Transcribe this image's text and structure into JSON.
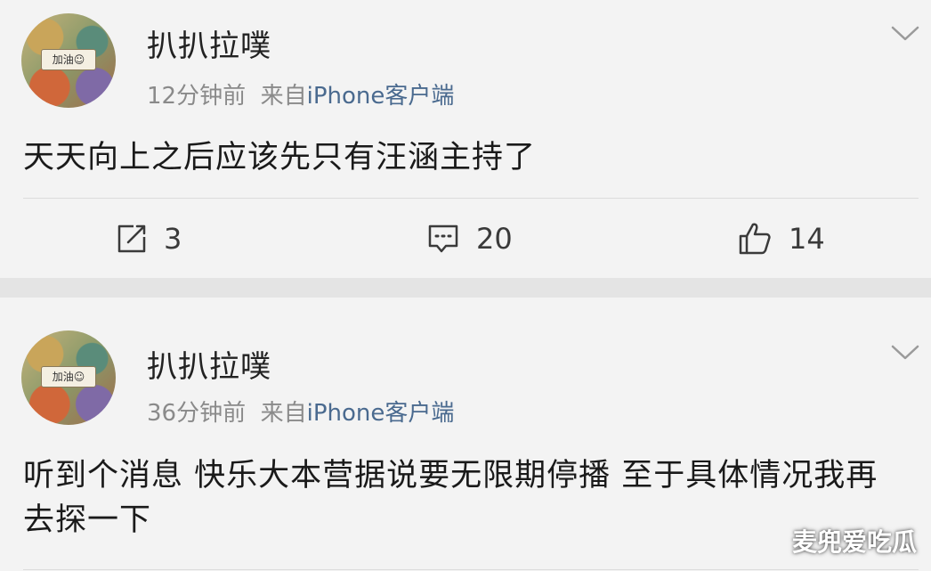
{
  "posts": [
    {
      "username": "扒扒拉噗",
      "avatar_tag": "加油☺",
      "time": "12分钟前",
      "source_prefix": "来自",
      "source_client": "iPhone客户端",
      "content": "天天向上之后应该先只有汪涵主持了",
      "actions": {
        "repost_count": "3",
        "comment_count": "20",
        "like_count": "14"
      }
    },
    {
      "username": "扒扒拉噗",
      "avatar_tag": "加油☺",
      "time": "36分钟前",
      "source_prefix": "来自",
      "source_client": "iPhone客户端",
      "content": "听到个消息 快乐大本营据说要无限期停播 至于具体情况我再去探一下"
    }
  ],
  "watermark": "麦兜爱吃瓜",
  "colors": {
    "background": "#f3f3f3",
    "meta_text": "#8a8a8a",
    "client_link": "#4a6a8f",
    "separator": "#e4e4e4"
  },
  "icons": [
    "chevron-down-icon",
    "repost-icon",
    "comment-icon",
    "like-icon"
  ]
}
